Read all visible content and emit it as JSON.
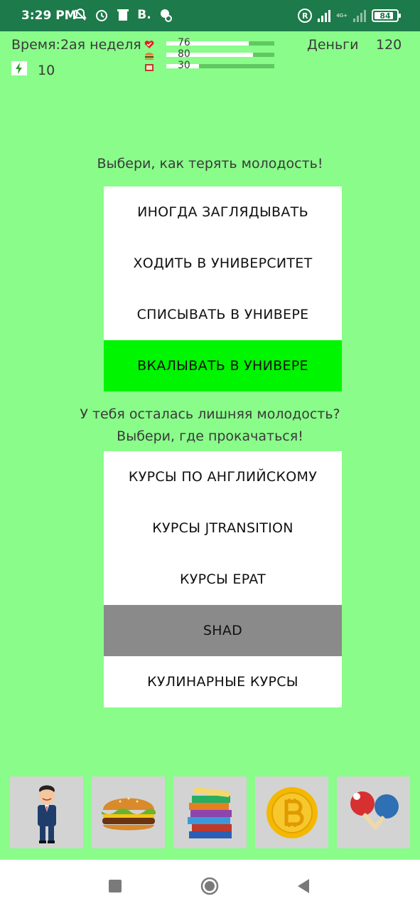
{
  "status_bar": {
    "time": "3:29 PM",
    "b_label": "B.",
    "reg_label": "R",
    "net_label": "4G+",
    "battery": "84"
  },
  "hud": {
    "time_label": "Время:2ая неделя",
    "money_label": "Деньги",
    "money_value": "120",
    "energy_value": "10",
    "stats": [
      {
        "icon": "heart-icon",
        "value": "76",
        "fraction": 0.76
      },
      {
        "icon": "burger-icon",
        "value": "80",
        "fraction": 0.8
      },
      {
        "icon": "book-icon",
        "value": "30",
        "fraction": 0.3
      }
    ]
  },
  "study": {
    "title": "Выбери, как терять молодость!",
    "options": [
      "ИНОГДА ЗАГЛЯДЫВАТЬ",
      "ХОДИТЬ В УНИВЕРСИТЕТ",
      "СПИСЫВАТЬ В УНИВЕРЕ",
      "ВКАЛЫВАТЬ В УНИВЕРЕ"
    ],
    "selected_color": "#00f500"
  },
  "courses": {
    "title_line1": "У тебя осталась лишняя молодость?",
    "title_line2": "Выбери, где прокачаться!",
    "options": [
      "КУРСЫ ПО АНГЛИЙСКОМУ",
      "КУРСЫ JTRANSITION",
      "КУРСЫ EPAT",
      "SHAD",
      "КУЛИНАРНЫЕ КУРСЫ"
    ],
    "active_color": "#8a8a8a"
  },
  "tabs": [
    "person-icon",
    "burger-icon",
    "books-icon",
    "bitcoin-icon",
    "ping-pong-icon"
  ],
  "colors": {
    "background": "#89fc89",
    "status_bar": "#1d7a4a"
  }
}
